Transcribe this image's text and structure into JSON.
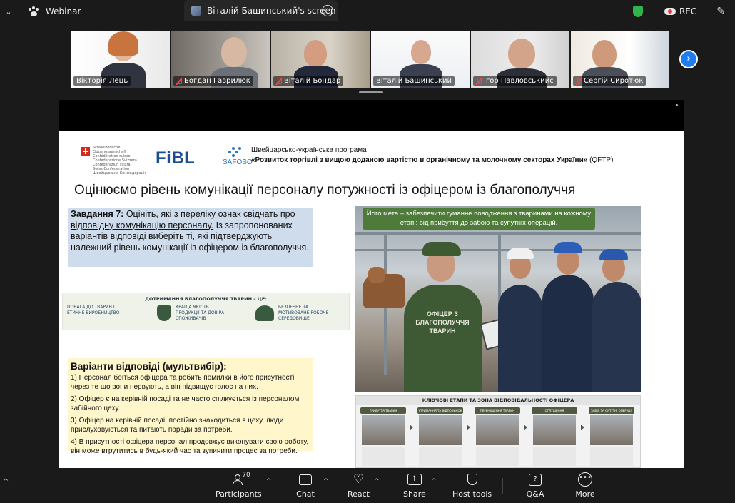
{
  "topbar": {
    "app_name": "Webinar",
    "tab_title": "Віталій Башинський's screen",
    "tab_more": "⋯",
    "rec_label": "REC",
    "edit_icon": "✎",
    "chevron_left": "⌄",
    "icons": {
      "app": "paw-icon",
      "security": "shield-icon",
      "record": "cloud-record-icon",
      "annotate": "pencil-icon"
    }
  },
  "participants_strip": {
    "tiles": [
      {
        "name": "Вікторія Лець",
        "muted": false,
        "active": false
      },
      {
        "name": "Богдан Гаврилюк",
        "muted": true,
        "active": false
      },
      {
        "name": "Віталій Бондар",
        "muted": true,
        "active": false
      },
      {
        "name": "Віталій Башинський",
        "muted": false,
        "active": true
      },
      {
        "name": "Ігор Павловськийс",
        "muted": true,
        "active": false
      },
      {
        "name": "Сергій Сиротюк",
        "muted": true,
        "active": false
      }
    ],
    "next_label": "›",
    "active_color": "#2ecc71",
    "next_color": "#1e7cf2"
  },
  "slide": {
    "logos": {
      "confederation_text": "Schweizerische Eidgenossenschaft Confédération suisse Confederazione Svizzera Confederaziun svizra",
      "confederation_text2": "Swiss Confederation Швейцарська Конфедерація",
      "fibl": "FiBL",
      "safoso": "SAFOSO"
    },
    "program_line1": "Швейцарсько-українська програма",
    "program_line2": "«Розвиток торгівлі з вищою доданою вартістю в органічному та молочному секторах України»",
    "program_code": "(QFTP)",
    "title": "Оцінюємо рівень комунікації персоналу потужності із офіцером із благополуччя",
    "task_label": "Завдання 7:",
    "task_underlined": "Оцініть, які з переліку ознак свідчать про відповідну комунікацію персоналу.",
    "task_rest": "Із запропонованих варіантів відповіді виберіть ті, які підтверджують належний рівень комунікації із офіцером із благополуччя.",
    "task_bg": "#cfdcec",
    "welfare": {
      "title": "ДОТРИМАННЯ БЛАГОПОЛУЧЧЯ ТВАРИН – ЦЕ:",
      "items": [
        {
          "icon": "cow-icon",
          "text": "ПОВАГА ДО ТВАРИН І ЕТИЧНЕ ВИРОБНИЦТВО"
        },
        {
          "icon": "shield-check-icon",
          "text": "КРАЩА ЯКІСТЬ ПРОДУКЦІЇ ТА ДОВІРА СПОЖИВАЧІВ"
        },
        {
          "icon": "people-group-icon",
          "text": "БЕЗПЕЧНЕ ТА МОТИВОВАНЕ РОБОЧЕ СЕРЕДОВИЩЕ"
        }
      ]
    },
    "answers": {
      "title": "Варіанти відповіді (мультвибір):",
      "items": [
        "1) Персонал боїться офіцера та робить помилки в його присутності через те що вони нервують, а він підвищує голос на них.",
        "2) Офіцер є на керівній посаді та не часто спілкується із персоналом забійного цеху.",
        "3) Офіцер на керівній посаді, постійно знаходиться в цеху, люди прислуховуються та питають поради за потреби.",
        "4) В присутності офіцера персонал продовжує виконувати свою роботу, він може втрутитись в будь-який час та зупинити процес за потреби."
      ],
      "bg": "#fff6cc"
    },
    "illustration": {
      "goal": "Його мета – забезпечити гуманне поводження з тваринами на кожному етапі: від прибуття до забою та супутніх операцій.",
      "officer_label": "ОФІЦЕР З БЛАГОПОЛУЧЧЯ ТВАРИН",
      "goal_color": "#4e7a3a"
    },
    "stages": {
      "title": "КЛЮЧОВІ ЕТАПИ ТА ЗОНА ВІДПОВІДАЛЬНОСТІ ОФІЦЕРА",
      "items": [
        "ПРИБУТТЯ ТВАРИН",
        "УТРИМАННЯ ТА ВІДПОЧИНОК",
        "ПЕРЕМІЩЕННЯ ТВАРИН",
        "ОГЛУШЕННЯ",
        "ЗАБІЙ ТА СУПУТНІ ОПЕРАЦІЇ"
      ]
    }
  },
  "toolbar": {
    "participants_label": "Participants",
    "participants_count": "70",
    "chat_label": "Chat",
    "react_label": "React",
    "share_label": "Share",
    "host_tools_label": "Host tools",
    "qa_label": "Q&A",
    "more_label": "More",
    "caret": "^",
    "chevron_left": "^",
    "share_glyph": "↑",
    "qa_glyph": "?",
    "more_glyph": "•••",
    "react_glyph": "♡"
  }
}
